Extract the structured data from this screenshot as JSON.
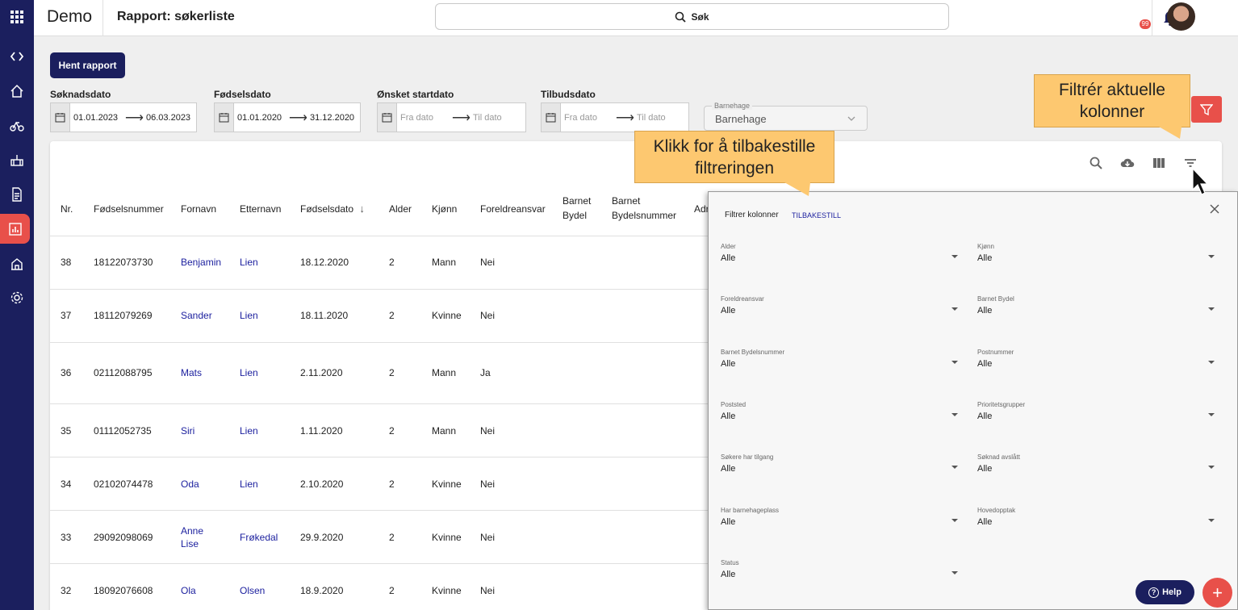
{
  "app": {
    "name": "Demo",
    "page_title": "Rapport: søkerliste"
  },
  "search": {
    "label": "Søk"
  },
  "notifications": {
    "count": "99"
  },
  "actions": {
    "fetch_report": "Hent rapport"
  },
  "filters": {
    "soknadsdato": {
      "label": "Søknadsdato",
      "from": "01.01.2023",
      "to": "06.03.2023"
    },
    "fodselsdato": {
      "label": "Fødselsdato",
      "from": "01.01.2020",
      "to": "31.12.2020"
    },
    "onsket_startdato": {
      "label": "Ønsket startdato",
      "from_placeholder": "Fra dato",
      "to_placeholder": "Til dato"
    },
    "tilbudsdato": {
      "label": "Tilbudsdato",
      "from_placeholder": "Fra dato",
      "to_placeholder": "Til dato"
    },
    "barnehage": {
      "label": "Barnehage",
      "value": "Barnehage"
    }
  },
  "table": {
    "headers": [
      "Nr.",
      "Fødselsnummer",
      "Fornavn",
      "Etternavn",
      "Fødselsdato",
      "Alder",
      "Kjønn",
      "Foreldreansvar",
      "Barnet Bydel",
      "Barnet Bydelsnummer",
      "Adr"
    ],
    "headers_wrapped": {
      "barnet_bydel": [
        "Barnet",
        "Bydel"
      ],
      "barnet_bydelsnummer": [
        "Barnet",
        "Bydelsnummer"
      ]
    },
    "rows": [
      {
        "nr": "38",
        "fnr": "18122073730",
        "fornavn": "Benjamin",
        "etternavn": "Lien",
        "fdato": "18.12.2020",
        "alder": "2",
        "kjonn": "Mann",
        "foreldreansvar": "Nei"
      },
      {
        "nr": "37",
        "fnr": "18112079269",
        "fornavn": "Sander",
        "etternavn": "Lien",
        "fdato": "18.11.2020",
        "alder": "2",
        "kjonn": "Kvinne",
        "foreldreansvar": "Nei"
      },
      {
        "nr": "36",
        "fnr": "02112088795",
        "fornavn": "Mats",
        "etternavn": "Lien",
        "fdato": "2.11.2020",
        "alder": "2",
        "kjonn": "Mann",
        "foreldreansvar": "Ja"
      },
      {
        "nr": "35",
        "fnr": "01112052735",
        "fornavn": "Siri",
        "etternavn": "Lien",
        "fdato": "1.11.2020",
        "alder": "2",
        "kjonn": "Mann",
        "foreldreansvar": "Nei"
      },
      {
        "nr": "34",
        "fnr": "02102074478",
        "fornavn": "Oda",
        "etternavn": "Lien",
        "fdato": "2.10.2020",
        "alder": "2",
        "kjonn": "Kvinne",
        "foreldreansvar": "Nei"
      },
      {
        "nr": "33",
        "fnr": "29092098069",
        "fornavn": "Anne Lise",
        "fornavn_line1": "Anne",
        "fornavn_line2": "Lise",
        "etternavn": "Frøkedal",
        "fdato": "29.9.2020",
        "alder": "2",
        "kjonn": "Kvinne",
        "foreldreansvar": "Nei"
      },
      {
        "nr": "32",
        "fnr": "18092076608",
        "fornavn": "Ola",
        "etternavn": "Olsen",
        "fdato": "18.9.2020",
        "alder": "2",
        "kjonn": "Kvinne",
        "foreldreansvar": "Nei"
      }
    ]
  },
  "filter_panel": {
    "title": "Filtrer kolonner",
    "reset_label": "TILBAKESTILL",
    "fields": [
      {
        "label": "Alder",
        "value": "Alle"
      },
      {
        "label": "Kjønn",
        "value": "Alle"
      },
      {
        "label": "Foreldreansvar",
        "value": "Alle"
      },
      {
        "label": "Barnet Bydel",
        "value": "Alle"
      },
      {
        "label": "Barnet Bydelsnummer",
        "value": "Alle"
      },
      {
        "label": "Postnummer",
        "value": "Alle"
      },
      {
        "label": "Poststed",
        "value": "Alle"
      },
      {
        "label": "Prioritetsgrupper",
        "value": "Alle"
      },
      {
        "label": "Søkere har tilgang",
        "value": "Alle"
      },
      {
        "label": "Søknad avslått",
        "value": "Alle"
      },
      {
        "label": "Har barnehageplass",
        "value": "Alle"
      },
      {
        "label": "Hovedopptak",
        "value": "Alle"
      },
      {
        "label": "Status",
        "value": "Alle"
      }
    ]
  },
  "tooltips": {
    "filter_columns": "Filtrér aktuelle kolonner",
    "filter_columns_l1": "Filtrér aktuelle",
    "filter_columns_l2": "kolonner",
    "reset": "Klikk for å tilbakestille filtreringen",
    "reset_l1": "Klikk for å tilbakestille",
    "reset_l2": "filtreringen"
  },
  "help": {
    "label": "Help"
  },
  "colors": {
    "sidebar": "#1b1f5e",
    "accent": "#e8504a",
    "tooltip": "#fdc870",
    "link": "#1b1f9e"
  }
}
